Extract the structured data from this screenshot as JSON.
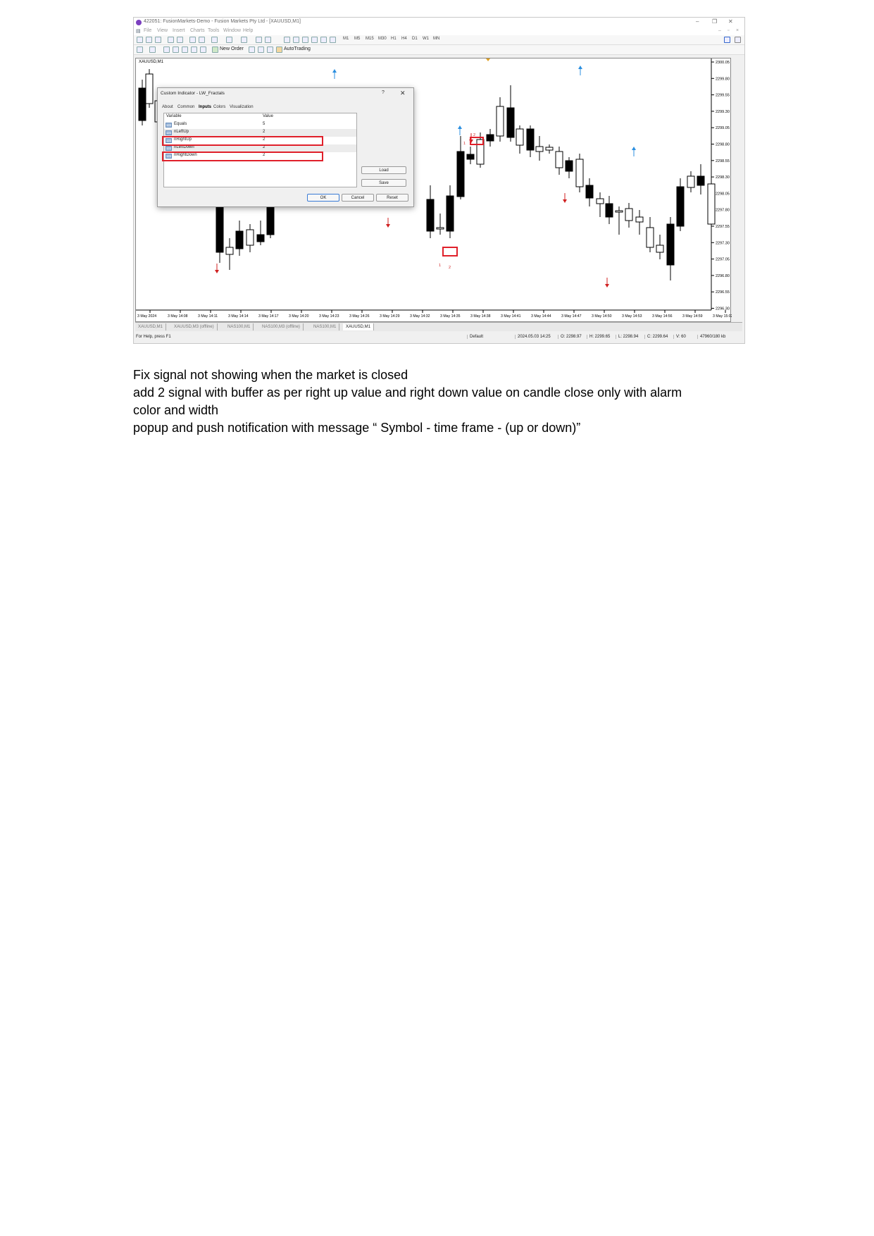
{
  "window": {
    "title": "422051: FusionMarkets-Demo - Fusion Markets Pty Ltd - [XAUUSD,M1]",
    "menu": [
      "File",
      "View",
      "Insert",
      "Charts",
      "Tools",
      "Window",
      "Help"
    ],
    "timeframes": [
      "M1",
      "M5",
      "M15",
      "M30",
      "H1",
      "H4",
      "D1",
      "W1",
      "MN"
    ],
    "new_order": "New Order",
    "autotrading": "AutoTrading"
  },
  "chart": {
    "symbol_tag": "XAUUSD,M1",
    "price_labels": [
      "2300.05",
      "2299.80",
      "2299.55",
      "2299.30",
      "2299.05",
      "2298.80",
      "2298.55",
      "2298.30",
      "2298.05",
      "2297.80",
      "2297.55",
      "2297.30",
      "2297.05",
      "2296.80",
      "2296.55",
      "2296.30"
    ],
    "time_labels": [
      "3 May 2024",
      "3 May 14:08",
      "3 May 14:11",
      "3 May 14:14",
      "3 May 14:17",
      "3 May 14:20",
      "3 May 14:23",
      "3 May 14:26",
      "3 May 14:29",
      "3 May 14:32",
      "3 May 14:35",
      "3 May 14:38",
      "3 May 14:41",
      "3 May 14:44",
      "3 May 14:47",
      "3 May 14:50",
      "3 May 14:53",
      "3 May 14:56",
      "3 May 14:59",
      "3 May 15:02"
    ],
    "fractal_marks": [
      "1",
      "2",
      "1",
      "2",
      "1"
    ]
  },
  "tabs": [
    "XAUUSD,M1",
    "XAUUSD,M3 (offline)",
    "NAS100,M1",
    "NAS100,M3 (offline)",
    "NAS100,M1",
    "XAUUSD,M1"
  ],
  "status": {
    "help": "For Help, press F1",
    "profile": "Default",
    "datetime": "2024.05.03 14:25",
    "open": "O: 2298.97",
    "high": "H: 2299.65",
    "low": "L: 2298.94",
    "close": "C: 2299.64",
    "volume": "V: 60",
    "traffic": "47960/180 kb"
  },
  "dialog": {
    "title": "Custom Indicator - LW_Fractals",
    "help": "?",
    "tabs": [
      "About",
      "Common",
      "Inputs",
      "Colors",
      "Visualization"
    ],
    "col_variable": "Variable",
    "col_value": "Value",
    "rows": [
      {
        "icon": "123",
        "name": "Equals",
        "value": "5"
      },
      {
        "icon": "123",
        "name": "nLeftUp",
        "value": "2"
      },
      {
        "icon": "123",
        "name": "nRightUp",
        "value": "2"
      },
      {
        "icon": "123",
        "name": "nLeftDown",
        "value": "2"
      },
      {
        "icon": "123",
        "name": "nRightDown",
        "value": "2"
      }
    ],
    "load": "Load",
    "save": "Save",
    "ok": "OK",
    "cancel": "Cancel",
    "reset": "Reset"
  },
  "notes": {
    "line1": "Fix signal not showing when the market is closed",
    "line2": "add 2 signal with buffer as per right up value and right down value on candle close only with alarm",
    "line3": "color and width",
    "line4": "popup and push notification with message “ Symbol - time frame - (up or down)”"
  }
}
